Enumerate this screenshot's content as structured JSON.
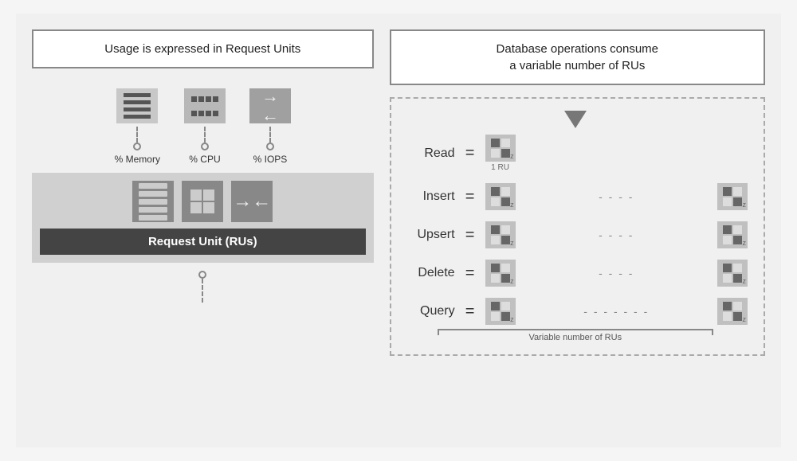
{
  "left": {
    "title": "Usage is expressed in Request Units",
    "icons": [
      {
        "id": "memory",
        "label": "% Memory"
      },
      {
        "id": "cpu",
        "label": "% CPU"
      },
      {
        "id": "iops",
        "label": "% IOPS"
      }
    ],
    "ru_label": "Request Unit (RUs)"
  },
  "right": {
    "title": "Database operations consume\na variable number of RUs",
    "operations": [
      {
        "label": "Read",
        "ru_label": "1 RU",
        "has_range": false
      },
      {
        "label": "Insert",
        "ru_label": "",
        "has_range": true
      },
      {
        "label": "Upsert",
        "ru_label": "",
        "has_range": true
      },
      {
        "label": "Delete",
        "ru_label": "",
        "has_range": true
      },
      {
        "label": "Query",
        "ru_label": "",
        "has_range": true,
        "long_dash": true
      }
    ],
    "variable_label": "Variable number of RUs"
  }
}
